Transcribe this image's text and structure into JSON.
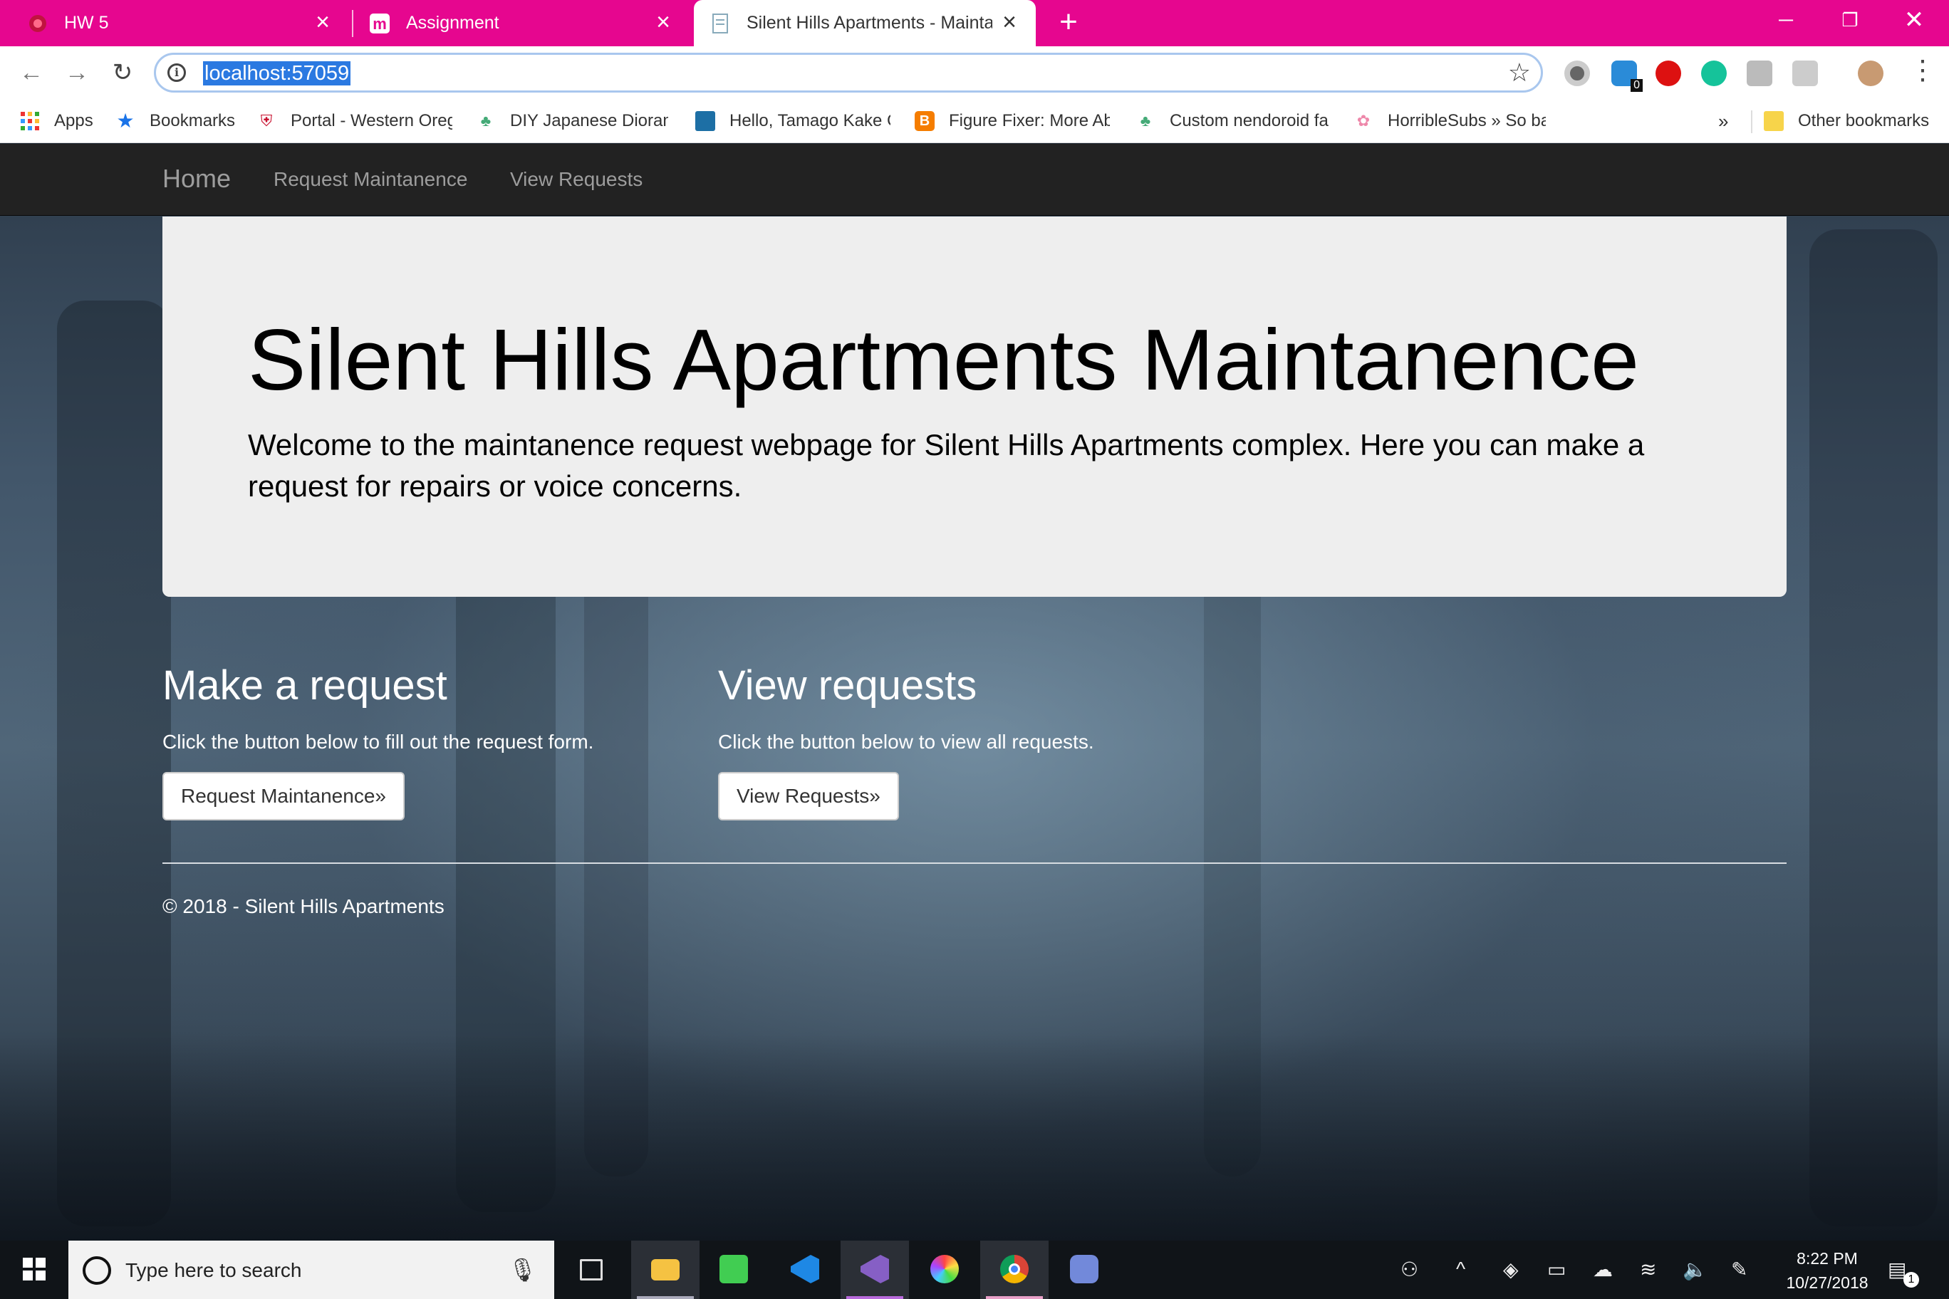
{
  "browser": {
    "tabs": [
      {
        "label": "HW 5"
      },
      {
        "label": "Assignment"
      },
      {
        "label": "Silent Hills Apartments - Maintan"
      }
    ],
    "url": "localhost:57059",
    "bookmarks": [
      {
        "label": "Apps",
        "icon": "apps-grid-icon"
      },
      {
        "label": "Bookmarks",
        "icon": "star-icon"
      },
      {
        "label": "Portal - Western Oreg",
        "icon": "shield-icon"
      },
      {
        "label": "DIY Japanese Dioram",
        "icon": "leaf-icon"
      },
      {
        "label": "Hello, Tamago Kake G",
        "icon": "folder-icon"
      },
      {
        "label": "Figure Fixer: More Ab",
        "icon": "blogger-icon"
      },
      {
        "label": "Custom nendoroid fa",
        "icon": "leaf-icon"
      },
      {
        "label": "HorribleSubs » So ba",
        "icon": "flower-icon"
      }
    ],
    "overflow": "»",
    "other_bookmarks": "Other bookmarks",
    "ext_badge": "0"
  },
  "site": {
    "nav": {
      "brand": "Home",
      "links": [
        "Request Maintanence",
        "View Requests"
      ]
    },
    "hero": {
      "title": "Silent Hills Apartments Maintanence",
      "text": "Welcome to the maintanence request webpage for Silent Hills Apartments complex. Here you can make a request for repairs or voice concerns."
    },
    "columns": [
      {
        "heading": "Make a request",
        "text": "Click the button below to fill out the request form.",
        "button": "Request Maintanence»"
      },
      {
        "heading": "View requests",
        "text": "Click the button below to view all requests.",
        "button": "View Requests»"
      }
    ],
    "footer": "© 2018 - Silent Hills Apartments"
  },
  "taskbar": {
    "search_placeholder": "Type here to search",
    "time": "8:22 PM",
    "date": "10/27/2018",
    "notification_count": "1"
  },
  "colors": {
    "tab_strip": "#e6068f",
    "navbar": "#222222",
    "jumbotron": "#eeeeee",
    "url_selection": "#2b79e1"
  }
}
